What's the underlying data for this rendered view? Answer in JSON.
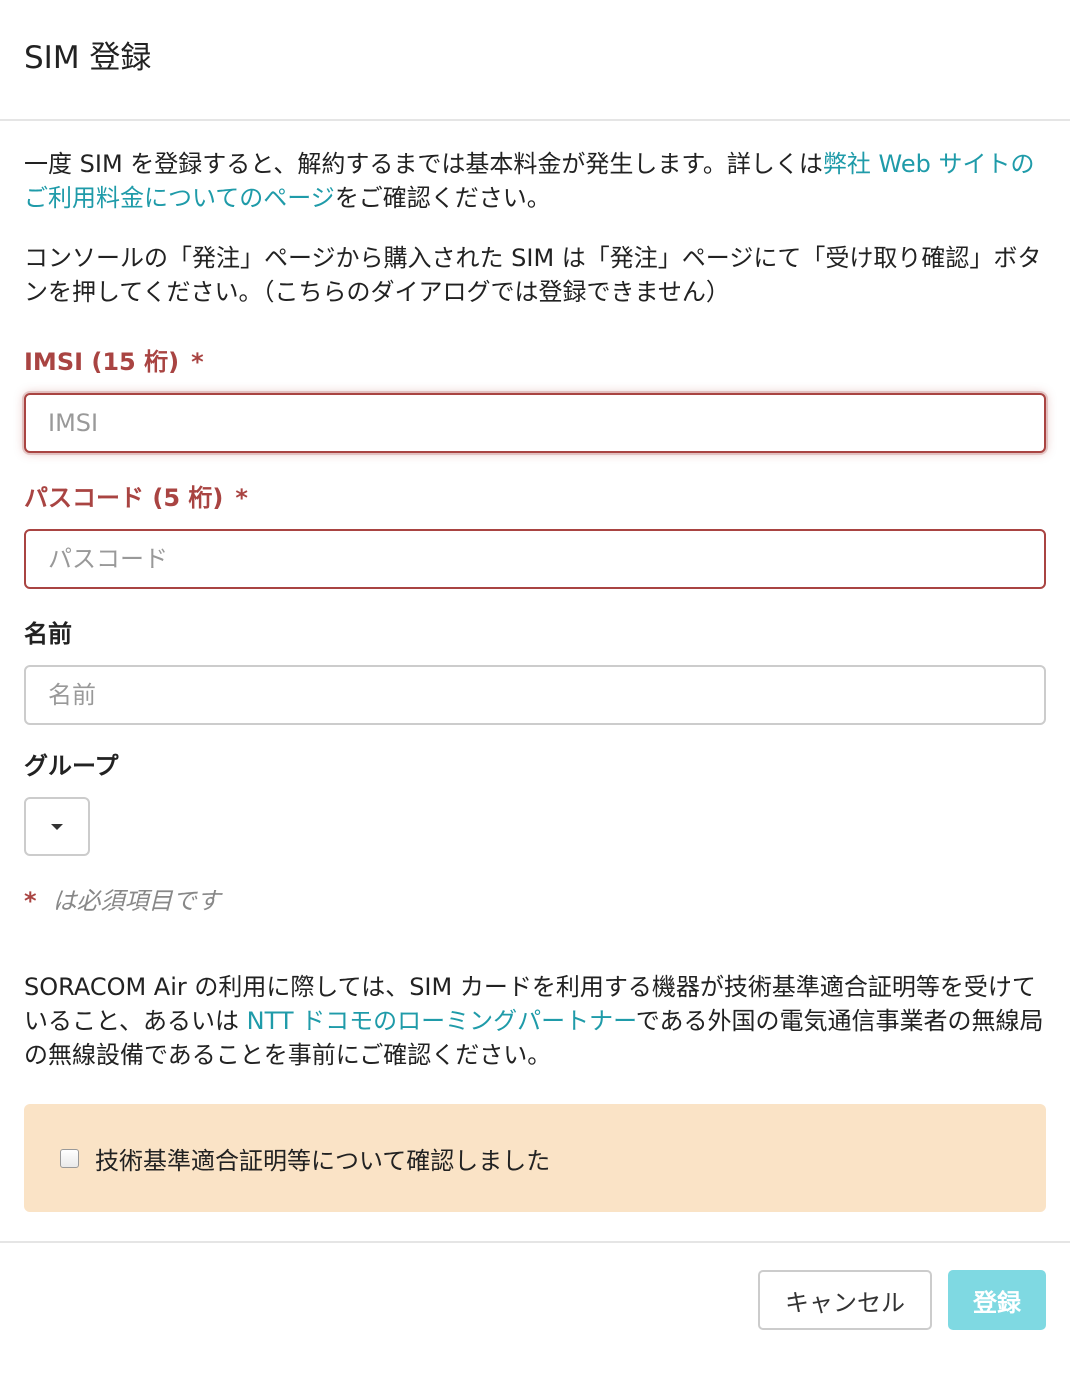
{
  "modal": {
    "title": "SIM 登録"
  },
  "intro": {
    "p1_before": "一度 SIM を登録すると、解約するまでは基本料金が発生します。詳しくは",
    "p1_link": "弊社 Web サイトのご利用料金についてのページ",
    "p1_after": "をご確認ください。",
    "p2": "コンソールの「発注」ページから購入された SIM は「発注」ページにて「受け取り確認」ボタンを押してください。（こちらのダイアログでは登録できません）"
  },
  "fields": {
    "imsi": {
      "label": "IMSI (15 桁)",
      "required_mark": "*",
      "placeholder": "IMSI",
      "value": ""
    },
    "passcode": {
      "label": "パスコード (5 桁)",
      "required_mark": "*",
      "placeholder": "パスコード",
      "value": ""
    },
    "name": {
      "label": "名前",
      "placeholder": "名前",
      "value": ""
    },
    "group": {
      "label": "グループ",
      "selected": ""
    }
  },
  "required_note": {
    "mark": "*",
    "text": "は必須項目です"
  },
  "notice": {
    "before": "SORACOM Air の利用に際しては、SIM カードを利用する機器が技術基準適合証明等を受けていること、あるいは ",
    "link": "NTT ドコモのローミングパートナー",
    "after": "である外国の電気通信事業者の無線局の無線設備であることを事前にご確認ください。"
  },
  "confirm": {
    "label": "技術基準適合証明等について確認しました",
    "checked": false
  },
  "footer": {
    "cancel_label": "キャンセル",
    "submit_label": "登録"
  },
  "colors": {
    "link": "#1f9ba9",
    "error": "#a94442",
    "confirm_bg": "#fae3c6",
    "submit_bg": "#7fd9e2"
  }
}
